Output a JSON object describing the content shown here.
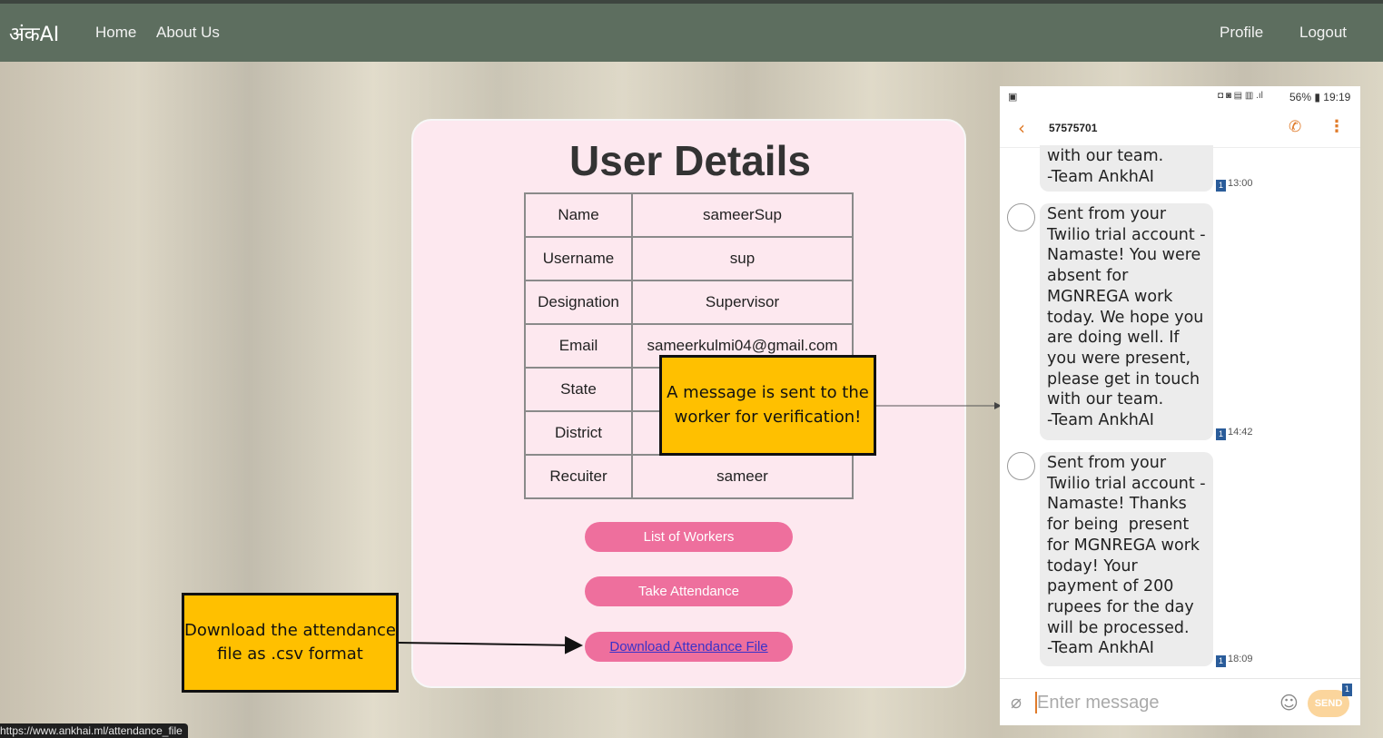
{
  "navbar": {
    "brand": "अंकAI",
    "home": "Home",
    "about": "About Us",
    "profile": "Profile",
    "logout": "Logout"
  },
  "card": {
    "title": "User Details",
    "rows": [
      {
        "label": "Name",
        "value": "sameerSup"
      },
      {
        "label": "Username",
        "value": "sup"
      },
      {
        "label": "Designation",
        "value": "Supervisor"
      },
      {
        "label": "Email",
        "value": "sameerkulmi04@gmail.com"
      },
      {
        "label": "State",
        "value": ""
      },
      {
        "label": "District",
        "value": ""
      },
      {
        "label": "Recuiter",
        "value": "sameer"
      }
    ],
    "buttons": {
      "list_workers": "List of Workers",
      "take_attendance": "Take Attendance",
      "download": "Download Attendance File"
    }
  },
  "callouts": {
    "message": "A message is sent to the worker for verification!",
    "download": "Download the attendance file as .csv format"
  },
  "statusbar": {
    "url": "https://www.ankhai.ml/attendance_file"
  },
  "phone": {
    "status": {
      "right": "56% ▮ 19:19"
    },
    "contact": "57575701",
    "messages": [
      {
        "text": "with our team.\n-Team AnkhAI",
        "time": "13:00",
        "sim": "1"
      },
      {
        "text": "Sent from your Twilio trial account - Namaste! You were absent for MGNREGA work today. We hope you are doing well. If you were present, please get in touch with our team.\n-Team AnkhAI",
        "time": "14:42",
        "sim": "1"
      },
      {
        "text": "Sent from your Twilio trial account - Namaste! Thanks for being  present for MGNREGA work today! Your payment of 200 rupees for the day will be processed.\n-Team AnkhAI",
        "time": "18:09",
        "sim": "1"
      }
    ],
    "input_placeholder": "Enter message",
    "send_label": "SEND",
    "send_badge": "1"
  },
  "colors": {
    "navbar": "#5d6e5f",
    "card": "#fde8ef",
    "button": "#ee6f9d",
    "callout": "#ffc000"
  }
}
